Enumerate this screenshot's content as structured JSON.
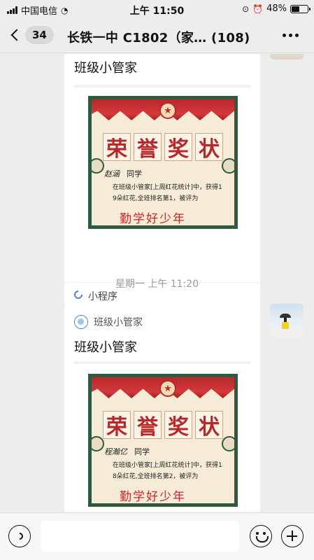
{
  "status_bar": {
    "carrier": "中国电信",
    "time": "上午 11:50",
    "battery_text": "48%",
    "battery_level": 0.48
  },
  "nav": {
    "unread_count": "34",
    "title": "长铁一中 C1802（家…  (108)"
  },
  "messages": [
    {
      "title": "班级小管家",
      "certificate": {
        "heading": [
          "荣",
          "誉",
          "奖",
          "状"
        ],
        "student_name": "赵涵",
        "salutation": "同学",
        "body_line1": "在班级小管家[上周红花统计]中，获得1",
        "body_line2": "9朵红花,全班排名第1，被评为",
        "award": "勤学好少年"
      },
      "footer_label": "小程序"
    },
    {
      "app_name": "班级小管家",
      "title": "班级小管家",
      "certificate": {
        "heading": [
          "荣",
          "誉",
          "奖",
          "状"
        ],
        "student_name": "程瀚亿",
        "salutation": "同学",
        "body_line1": "在班级小管家[上周红花统计]中，获得1",
        "body_line2": "8朵红花,全班排名第2，被评为",
        "award": "勤学好少年"
      }
    }
  ],
  "timestamp": "星期一 上午 11:20",
  "icons": {
    "back": "chevron-left-icon",
    "more": "more-dots-icon",
    "voice": "voice-icon",
    "emoji": "emoji-icon",
    "plus": "plus-icon",
    "mini_program": "mini-program-icon"
  }
}
